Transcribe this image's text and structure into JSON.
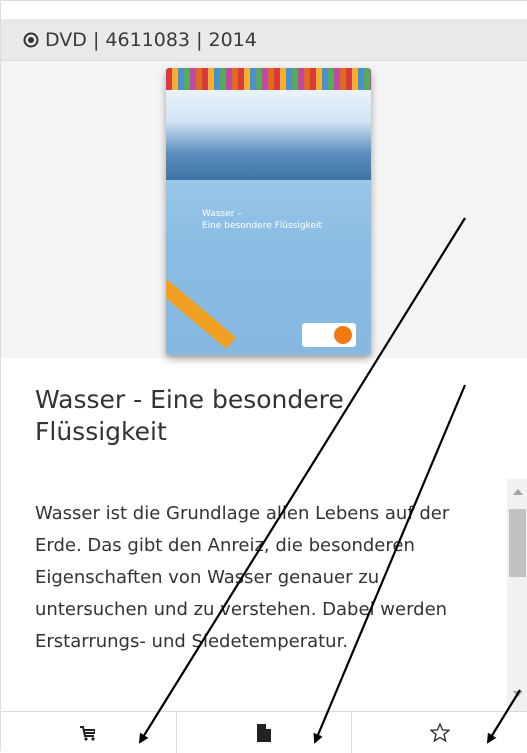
{
  "header": {
    "meta": "DVD | 4611083 | 2014",
    "icon": "radio-dot-icon"
  },
  "cover": {
    "title_line1": "Wasser –",
    "title_line2": "Eine besondere Flüssigkeit"
  },
  "item": {
    "title": "Wasser - Eine besondere Flüssigkeit",
    "description": "Wasser ist die Grundlage allen Lebens auf der Erde. Das gibt den Anreiz, die besonderen Eigenschaften von Wasser genauer zu untersuchen und zu verstehen. Dabei werden Erstarrungs- und Siedetemperatur."
  },
  "toolbar": {
    "icons": [
      "cart-icon",
      "document-icon",
      "star-outline-icon"
    ]
  },
  "colors": {
    "header_bg": "#e9e9e9",
    "text": "#333333",
    "arrow": "#000000"
  }
}
